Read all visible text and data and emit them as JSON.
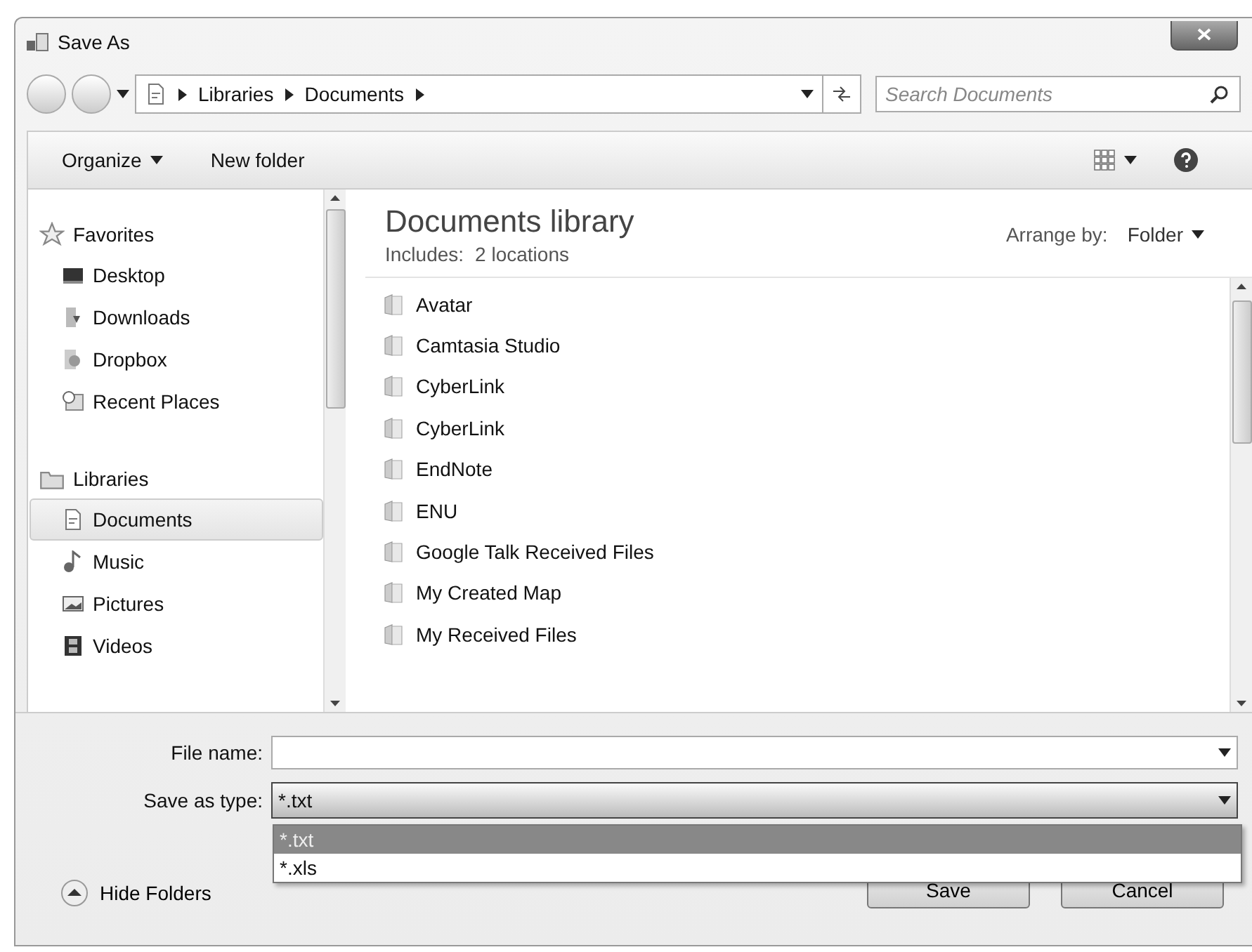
{
  "window": {
    "title": "Save As"
  },
  "address": {
    "segments": [
      "Libraries",
      "Documents"
    ]
  },
  "search": {
    "placeholder": "Search Documents"
  },
  "toolbar": {
    "organize": "Organize",
    "new_folder": "New folder"
  },
  "sidebar": {
    "groups": [
      {
        "label": "Favorites",
        "children": [
          {
            "label": "Desktop",
            "selected": false
          },
          {
            "label": "Downloads",
            "selected": false
          },
          {
            "label": "Dropbox",
            "selected": false
          },
          {
            "label": "Recent Places",
            "selected": false
          }
        ]
      },
      {
        "label": "Libraries",
        "children": [
          {
            "label": "Documents",
            "selected": true
          },
          {
            "label": "Music",
            "selected": false
          },
          {
            "label": "Pictures",
            "selected": false
          },
          {
            "label": "Videos",
            "selected": false
          }
        ]
      }
    ]
  },
  "content": {
    "title": "Documents library",
    "includes_label": "Includes:",
    "includes_value": "2 locations",
    "arrange_label": "Arrange by:",
    "arrange_value": "Folder"
  },
  "files": [
    "Avatar",
    "Camtasia Studio",
    "CyberLink",
    "CyberLink",
    "EndNote",
    "ENU",
    "Google Talk Received Files",
    "My Created Map",
    "My Received Files"
  ],
  "form": {
    "file_name_label": "File name:",
    "save_type_label": "Save as type:",
    "save_type_value": "*.txt",
    "options": [
      {
        "label": "*.txt",
        "selected": true
      },
      {
        "label": "*.xls",
        "selected": false
      }
    ]
  },
  "hide_folders": "Hide Folders",
  "buttons": [
    "Save",
    "Cancel"
  ]
}
